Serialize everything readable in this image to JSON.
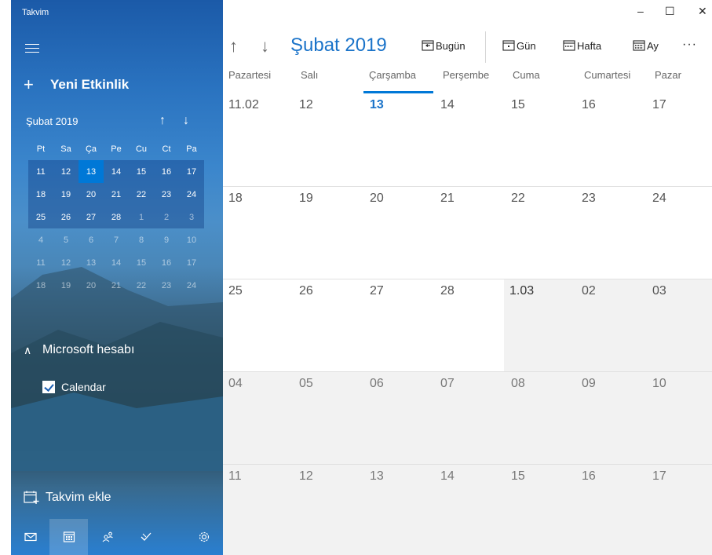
{
  "app": {
    "title": "Takvim"
  },
  "sidebar": {
    "new_event_label": "Yeni Etkinlik",
    "mini_calendar": {
      "month_label": "Şubat 2019",
      "weekday_headers": [
        "Pt",
        "Sa",
        "Ça",
        "Pe",
        "Cu",
        "Ct",
        "Pa"
      ],
      "weeks": [
        [
          "11",
          "12",
          "13",
          "14",
          "15",
          "16",
          "17"
        ],
        [
          "18",
          "19",
          "20",
          "21",
          "22",
          "23",
          "24"
        ],
        [
          "25",
          "26",
          "27",
          "28",
          "1",
          "2",
          "3"
        ],
        [
          "4",
          "5",
          "6",
          "7",
          "8",
          "9",
          "10"
        ],
        [
          "11",
          "12",
          "13",
          "14",
          "15",
          "16",
          "17"
        ],
        [
          "18",
          "19",
          "20",
          "21",
          "22",
          "23",
          "24"
        ]
      ],
      "today": "13"
    },
    "account_label": "Microsoft hesabı",
    "calendar_item_label": "Calendar",
    "calendar_item_checked": true,
    "add_calendar_label": "Takvim ekle",
    "bottom_icons": [
      "mail-icon",
      "calendar-icon",
      "people-icon",
      "todo-icon",
      "settings-icon"
    ]
  },
  "window_controls": {
    "minimize": "–",
    "maximize": "☐",
    "close": "✕"
  },
  "toolbar": {
    "up_arrow": "↑",
    "down_arrow": "↓",
    "month_title": "Şubat 2019",
    "today_label": "Bugün",
    "day_label": "Gün",
    "week_label": "Hafta",
    "month_label": "Ay",
    "more_label": "···"
  },
  "day_headers": [
    "Pazartesi",
    "Salı",
    "Çarşamba",
    "Perşembe",
    "Cuma",
    "Cumartesi",
    "Pazar"
  ],
  "month_grid": [
    [
      "11.02",
      "12",
      "13",
      "14",
      "15",
      "16",
      "17"
    ],
    [
      "18",
      "19",
      "20",
      "21",
      "22",
      "23",
      "24"
    ],
    [
      "25",
      "26",
      "27",
      "28",
      "1.03",
      "02",
      "03"
    ],
    [
      "04",
      "05",
      "06",
      "07",
      "08",
      "09",
      "10"
    ],
    [
      "11",
      "12",
      "13",
      "14",
      "15",
      "16",
      "17"
    ]
  ],
  "colors": {
    "accent": "#0078d7",
    "month_title": "#1a73c9"
  }
}
